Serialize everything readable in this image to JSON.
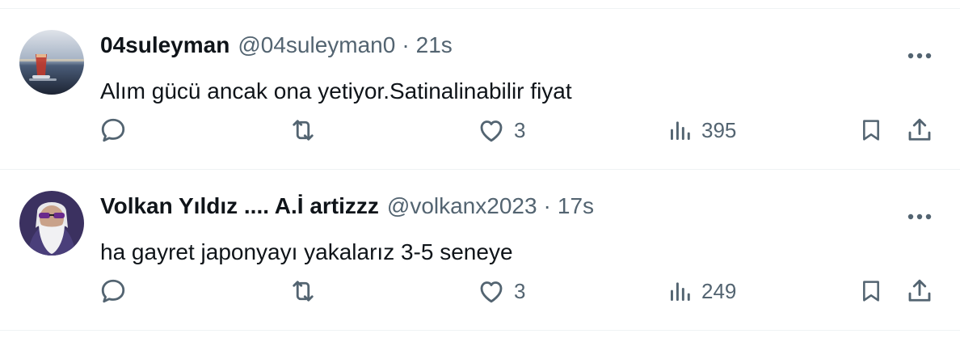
{
  "tweets": [
    {
      "display_name": "04suleyman",
      "handle": "@04suleyman0",
      "separator": "·",
      "time": "21s",
      "text": "Alım gücü ancak ona yetiyor.Satinalinabilir fiyat",
      "likes": "3",
      "views": "395",
      "avatar_colors": {
        "sky": "#a7b4c6",
        "sea": "#4a5c78",
        "glass": "#c0392b"
      }
    },
    {
      "display_name": "Volkan Yıldız .... A.İ artizzz",
      "handle": "@volkanx2023",
      "separator": "·",
      "time": "17s",
      "text": "ha gayret japonyayı yakalarız 3-5 seneye",
      "likes": "3",
      "views": "249",
      "avatar_colors": {
        "bg": "#3b3160",
        "hair": "#e8e8ea",
        "glasses": "#6a2a8c"
      }
    }
  ],
  "icons": [
    "more-icon",
    "reply-icon",
    "retweet-icon",
    "like-icon",
    "views-icon",
    "bookmark-icon",
    "share-icon"
  ],
  "colors": {
    "text": "#0f1419",
    "secondary": "#536471",
    "divider": "#eff3f4"
  }
}
